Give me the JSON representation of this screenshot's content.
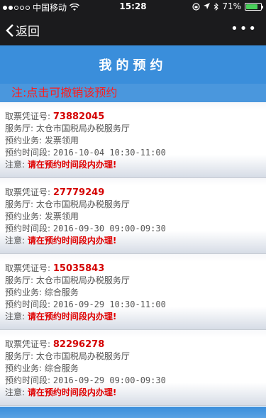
{
  "status_bar": {
    "carrier": "中国移动",
    "time": "15:28",
    "battery": "71%"
  },
  "nav": {
    "back_label": "返回",
    "more_label": "•••"
  },
  "header": {
    "title": "我的预约"
  },
  "notice": "注:点击可撤销该预约",
  "field_labels": {
    "ticket": "取票凭证号:",
    "hall": "服务厅:",
    "business": "预约业务:",
    "time": "预约时间段:",
    "note": "注意:"
  },
  "reservations": [
    {
      "ticket_no": "73882045",
      "hall": "太仓市国税局办税服务厅",
      "business": "发票领用",
      "time_slot": "2016-10-04  10:30-11:00",
      "note": "请在预约时间段内办理!"
    },
    {
      "ticket_no": "27779249",
      "hall": "太仓市国税局办税服务厅",
      "business": "发票领用",
      "time_slot": "2016-09-30  09:00-09:30",
      "note": "请在预约时间段内办理!"
    },
    {
      "ticket_no": "15035843",
      "hall": "太仓市国税局办税服务厅",
      "business": "综合服务",
      "time_slot": "2016-09-29  10:30-11:00",
      "note": "请在预约时间段内办理!"
    },
    {
      "ticket_no": "82296278",
      "hall": "太仓市国税局办税服务厅",
      "business": "综合服务",
      "time_slot": "2016-09-29  09:00-09:30",
      "note": "请在预约时间段内办理!"
    }
  ]
}
